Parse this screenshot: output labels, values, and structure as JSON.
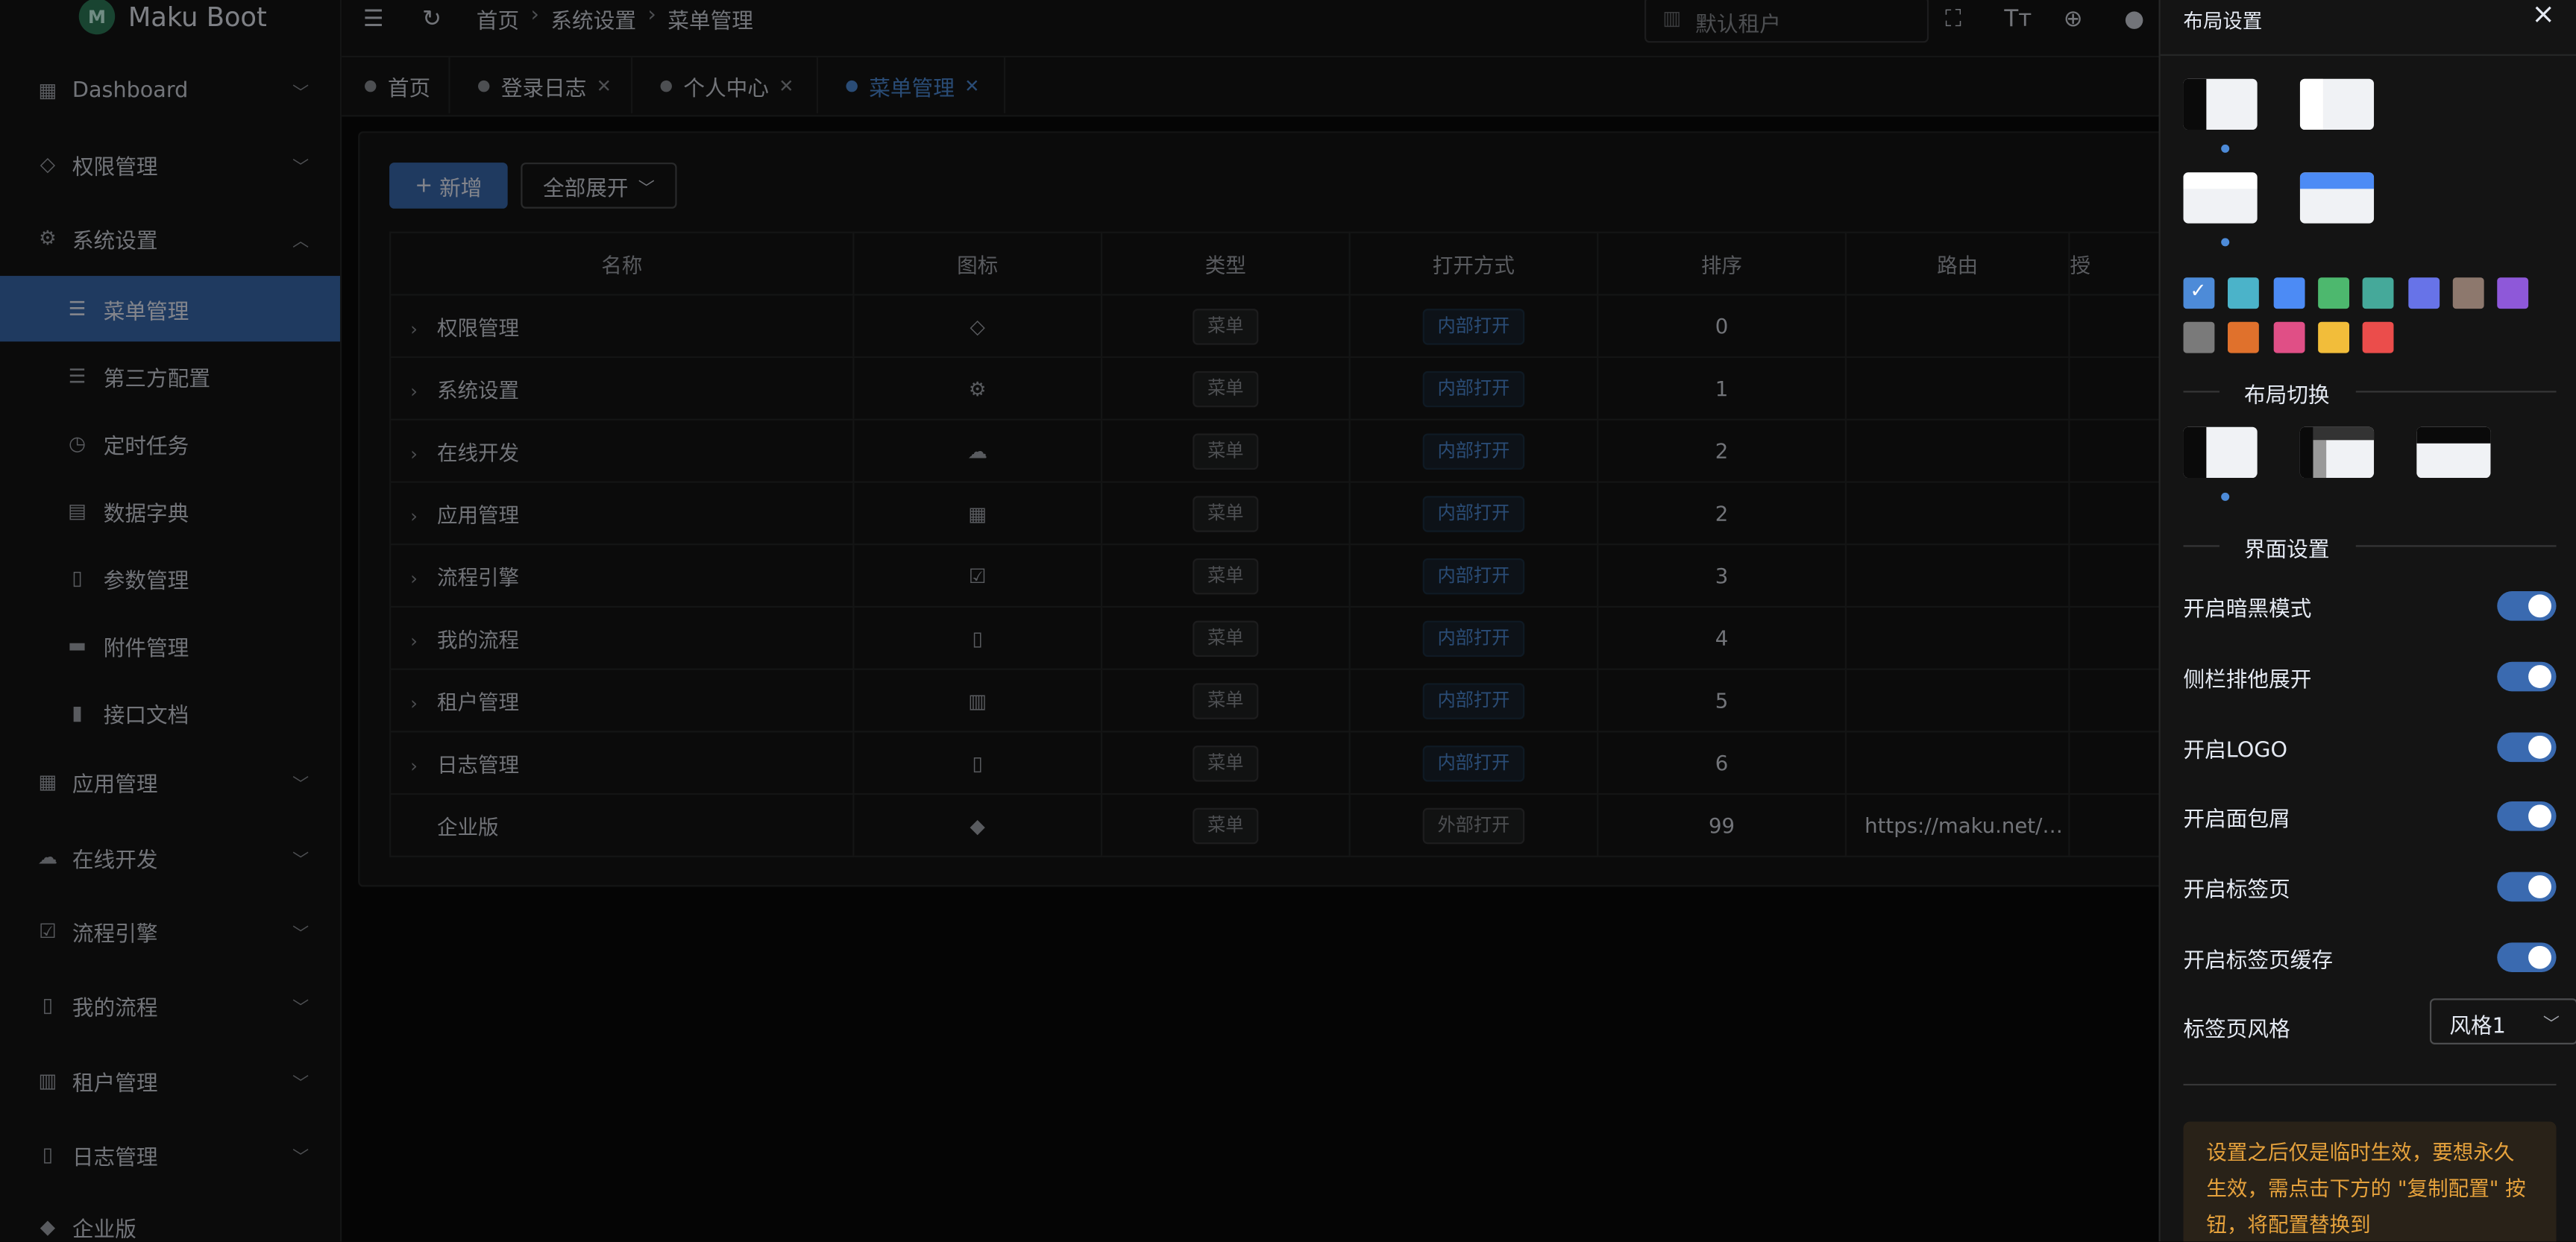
{
  "app": {
    "logo_text": "Maku Boot"
  },
  "sidebar": {
    "items": [
      {
        "label": "Dashboard"
      },
      {
        "label": "权限管理"
      },
      {
        "label": "系统设置"
      },
      {
        "label": "应用管理"
      },
      {
        "label": "在线开发"
      },
      {
        "label": "流程引擎"
      },
      {
        "label": "我的流程"
      },
      {
        "label": "租户管理"
      },
      {
        "label": "日志管理"
      },
      {
        "label": "企业版"
      }
    ],
    "subitems": [
      {
        "label": "菜单管理"
      },
      {
        "label": "第三方配置"
      },
      {
        "label": "定时任务"
      },
      {
        "label": "数据字典"
      },
      {
        "label": "参数管理"
      },
      {
        "label": "附件管理"
      },
      {
        "label": "接口文档"
      }
    ]
  },
  "header": {
    "breadcrumb": [
      "首页",
      "系统设置",
      "菜单管理"
    ],
    "tenant_placeholder": "默认租户"
  },
  "tabs": [
    {
      "label": "首页"
    },
    {
      "label": "登录日志"
    },
    {
      "label": "个人中心"
    },
    {
      "label": "菜单管理"
    }
  ],
  "toolbar": {
    "add_label": "新增",
    "add_icon": "+",
    "expand_label": "全部展开"
  },
  "table": {
    "columns": [
      "名称",
      "图标",
      "类型",
      "打开方式",
      "排序",
      "路由",
      "授"
    ],
    "rows": [
      {
        "name": "权限管理",
        "type": "菜单",
        "open": "内部打开",
        "sort": "0",
        "route": ""
      },
      {
        "name": "系统设置",
        "type": "菜单",
        "open": "内部打开",
        "sort": "1",
        "route": ""
      },
      {
        "name": "在线开发",
        "type": "菜单",
        "open": "内部打开",
        "sort": "2",
        "route": ""
      },
      {
        "name": "应用管理",
        "type": "菜单",
        "open": "内部打开",
        "sort": "2",
        "route": ""
      },
      {
        "name": "流程引擎",
        "type": "菜单",
        "open": "内部打开",
        "sort": "3",
        "route": ""
      },
      {
        "name": "我的流程",
        "type": "菜单",
        "open": "内部打开",
        "sort": "4",
        "route": ""
      },
      {
        "name": "租户管理",
        "type": "菜单",
        "open": "内部打开",
        "sort": "5",
        "route": ""
      },
      {
        "name": "日志管理",
        "type": "菜单",
        "open": "内部打开",
        "sort": "6",
        "route": ""
      },
      {
        "name": "企业版",
        "type": "菜单",
        "open": "外部打开",
        "sort": "99",
        "route": "https://maku.net/…"
      }
    ]
  },
  "drawer": {
    "title": "布局设置",
    "close_icon": "×",
    "theme_colors": [
      "#4d8bd8",
      "#4bb3c9",
      "#4c8bf5",
      "#4db86e",
      "#45a99a",
      "#6773e8",
      "#8d786d",
      "#8e58d9",
      "#7a7a7a",
      "#e0712c",
      "#e04f86",
      "#f2bd3a",
      "#eb4d4b"
    ],
    "section_layout": "布局切换",
    "section_ui": "界面设置",
    "settings": [
      {
        "label": "开启暗黑模式",
        "on": true
      },
      {
        "label": "侧栏排他展开",
        "on": true
      },
      {
        "label": "开启LOGO",
        "on": true
      },
      {
        "label": "开启面包屑",
        "on": true
      },
      {
        "label": "开启标签页",
        "on": true
      },
      {
        "label": "开启标签页缓存",
        "on": true
      }
    ],
    "tab_style_label": "标签页风格",
    "tab_style_value": "风格1",
    "notice": "设置之后仅是临时生效，要想永久生效，需点击下方的 \"复制配置\" 按钮，将配置替换到"
  }
}
